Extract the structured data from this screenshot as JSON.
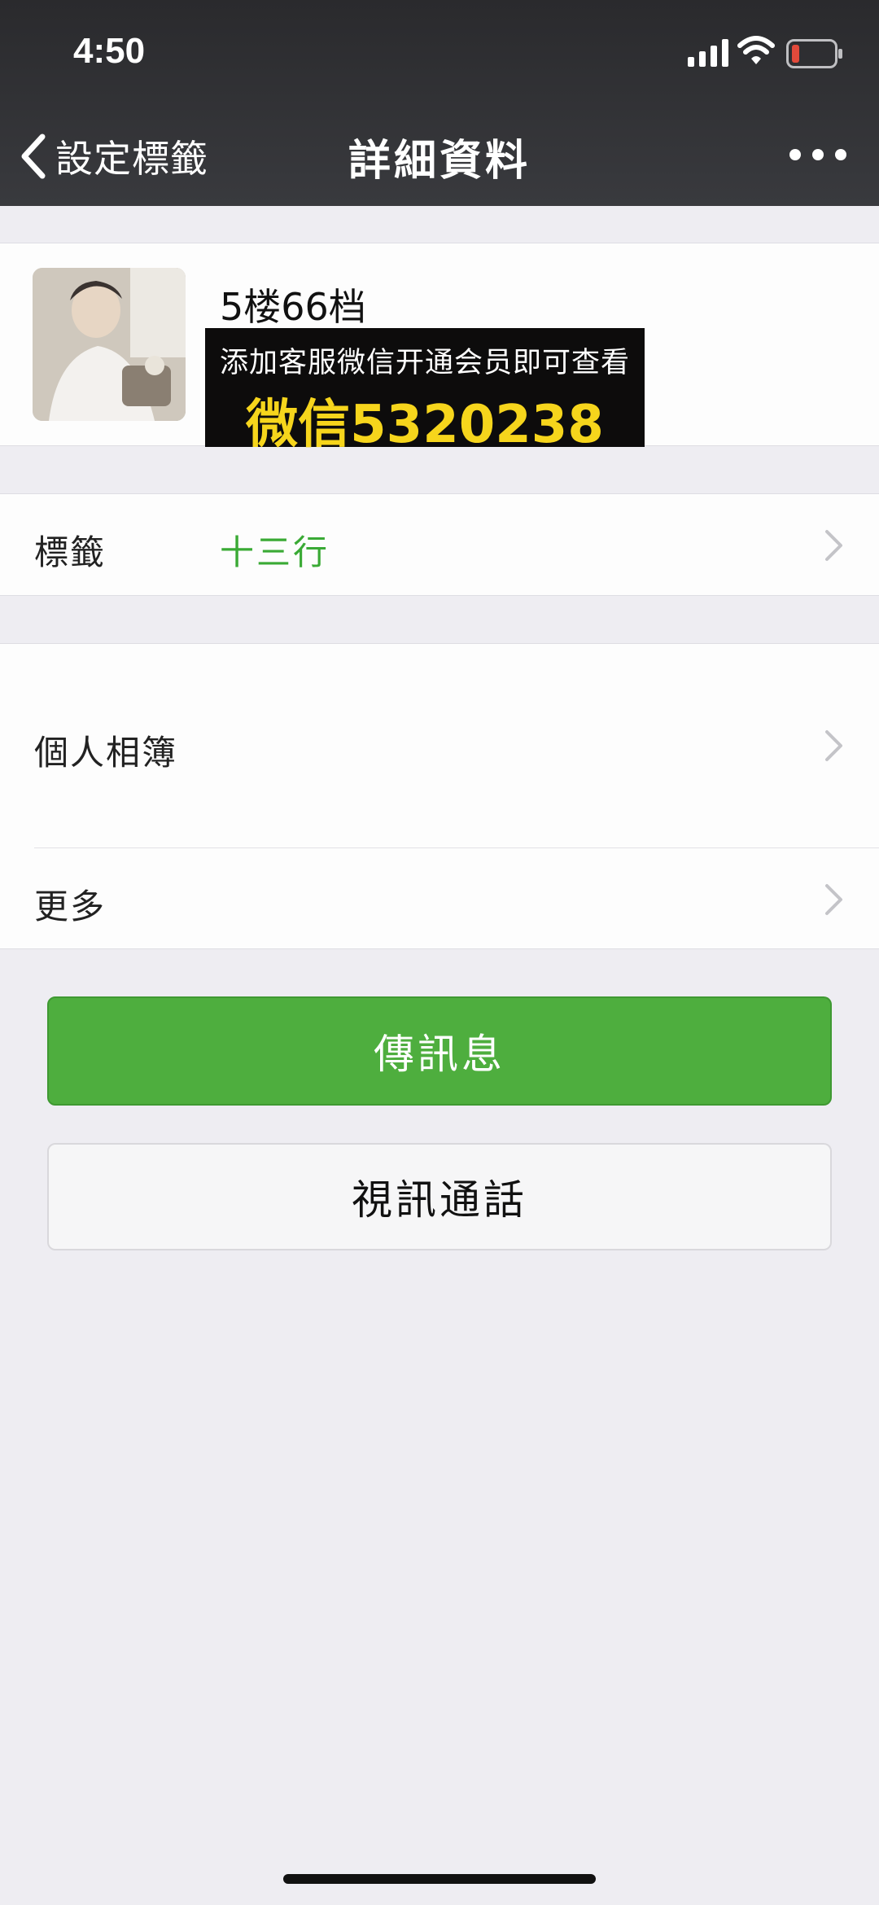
{
  "status_bar": {
    "time": "4:50",
    "icons": [
      "signal-icon",
      "wifi-icon",
      "battery-icon"
    ],
    "battery_color": "#e24a3b"
  },
  "nav": {
    "back_label": "設定標籤",
    "title": "詳細資料",
    "back_icon": "chevron-left-icon",
    "more_icon": "more-dots-icon"
  },
  "profile": {
    "name": "5楼66档",
    "promo_line1": "添加客服微信开通会员即可查看",
    "promo_line2": "微信5320238"
  },
  "rows": {
    "tag_label": "標籤",
    "tag_value": "十三行",
    "album_label": "個人相簿",
    "more_label": "更多"
  },
  "buttons": {
    "send_message": "傳訊息",
    "video_call": "視訊通話"
  },
  "colors": {
    "accent_green": "#4eae3e",
    "tag_text_green": "#3aaa35",
    "promo_yellow": "#f6d51c",
    "header_dark": "#393a3e",
    "background": "#eeedf2"
  }
}
